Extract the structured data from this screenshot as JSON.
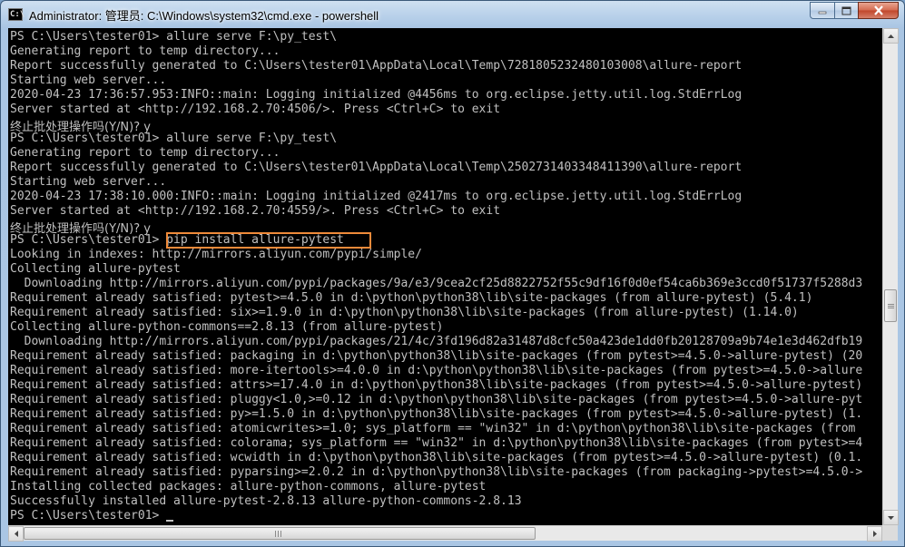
{
  "window": {
    "icon_text": "C:\\",
    "title": "Administrator: 管理员: C:\\Windows\\system32\\cmd.exe - powershell"
  },
  "console": {
    "lines": [
      "PS C:\\Users\\tester01> allure serve F:\\py_test\\",
      "Generating report to temp directory...",
      "Report successfully generated to C:\\Users\\tester01\\AppData\\Local\\Temp\\7281805232480103008\\allure-report",
      "Starting web server...",
      "2020-04-23 17:36:57.953:INFO::main: Logging initialized @4456ms to org.eclipse.jetty.util.log.StdErrLog",
      "Server started at <http://192.168.2.70:4506/>. Press <Ctrl+C> to exit",
      "终止批处理操作吗(Y/N)? y",
      "PS C:\\Users\\tester01> allure serve F:\\py_test\\",
      "Generating report to temp directory...",
      "Report successfully generated to C:\\Users\\tester01\\AppData\\Local\\Temp\\2502731403348411390\\allure-report",
      "Starting web server...",
      "2020-04-23 17:38:10.000:INFO::main: Logging initialized @2417ms to org.eclipse.jetty.util.log.StdErrLog",
      "Server started at <http://192.168.2.70:4559/>. Press <Ctrl+C> to exit",
      "终止批处理操作吗(Y/N)? y",
      "PS C:\\Users\\tester01> pip install allure-pytest",
      "Looking in indexes: http://mirrors.aliyun.com/pypi/simple/",
      "Collecting allure-pytest",
      "  Downloading http://mirrors.aliyun.com/pypi/packages/9a/e3/9cea2cf25d8822752f55c9df16f0d0ef54ca6b369e3ccd0f51737f5288d3",
      "Requirement already satisfied: pytest>=4.5.0 in d:\\python\\python38\\lib\\site-packages (from allure-pytest) (5.4.1)",
      "Requirement already satisfied: six>=1.9.0 in d:\\python\\python38\\lib\\site-packages (from allure-pytest) (1.14.0)",
      "Collecting allure-python-commons==2.8.13 (from allure-pytest)",
      "  Downloading http://mirrors.aliyun.com/pypi/packages/21/4c/3fd196d82a31487d8cfc50a423de1dd0fb20128709a9b74e1e3d462dfb19",
      "Requirement already satisfied: packaging in d:\\python\\python38\\lib\\site-packages (from pytest>=4.5.0->allure-pytest) (20",
      "Requirement already satisfied: more-itertools>=4.0.0 in d:\\python\\python38\\lib\\site-packages (from pytest>=4.5.0->allure",
      "Requirement already satisfied: attrs>=17.4.0 in d:\\python\\python38\\lib\\site-packages (from pytest>=4.5.0->allure-pytest)",
      "Requirement already satisfied: pluggy<1.0,>=0.12 in d:\\python\\python38\\lib\\site-packages (from pytest>=4.5.0->allure-pyt",
      "Requirement already satisfied: py>=1.5.0 in d:\\python\\python38\\lib\\site-packages (from pytest>=4.5.0->allure-pytest) (1.",
      "Requirement already satisfied: atomicwrites>=1.0; sys_platform == \"win32\" in d:\\python\\python38\\lib\\site-packages (from",
      "Requirement already satisfied: colorama; sys_platform == \"win32\" in d:\\python\\python38\\lib\\site-packages (from pytest>=4",
      "Requirement already satisfied: wcwidth in d:\\python\\python38\\lib\\site-packages (from pytest>=4.5.0->allure-pytest) (0.1.",
      "Requirement already satisfied: pyparsing>=2.0.2 in d:\\python\\python38\\lib\\site-packages (from packaging->pytest>=4.5.0->",
      "Installing collected packages: allure-python-commons, allure-pytest",
      "Successfully installed allure-pytest-2.8.13 allure-python-commons-2.8.13",
      "PS C:\\Users\\tester01> "
    ]
  },
  "colors": {
    "console_background": "#000000",
    "console_text": "#c0c0c0",
    "highlight_box": "#ef8a3a",
    "close_button": "#c0452a"
  }
}
